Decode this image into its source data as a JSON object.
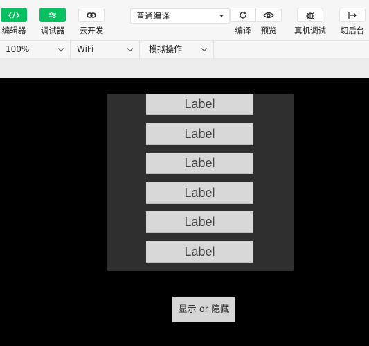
{
  "toolbar": {
    "editor": {
      "label": "编辑器",
      "icon": "code-icon"
    },
    "debugger": {
      "label": "调试器",
      "icon": "sliders-icon"
    },
    "cloud": {
      "label": "云开发",
      "icon": "cloud-link-icon"
    },
    "mode": {
      "value": "普通编译"
    },
    "compile": {
      "label": "编译",
      "icon": "refresh-icon"
    },
    "preview": {
      "label": "预览",
      "icon": "eye-icon"
    },
    "realdevice": {
      "label": "真机调试",
      "icon": "bug-icon"
    },
    "background": {
      "label": "切后台",
      "icon": "exit-icon"
    }
  },
  "subbar": {
    "zoom": "100%",
    "network": "WiFi",
    "simulate": "模拟操作"
  },
  "simulator": {
    "buttons": [
      "Label",
      "Label",
      "Label",
      "Label",
      "Label",
      "Label"
    ],
    "toggle_label": "显示 or 隐藏"
  },
  "colors": {
    "accent": "#07c160"
  }
}
